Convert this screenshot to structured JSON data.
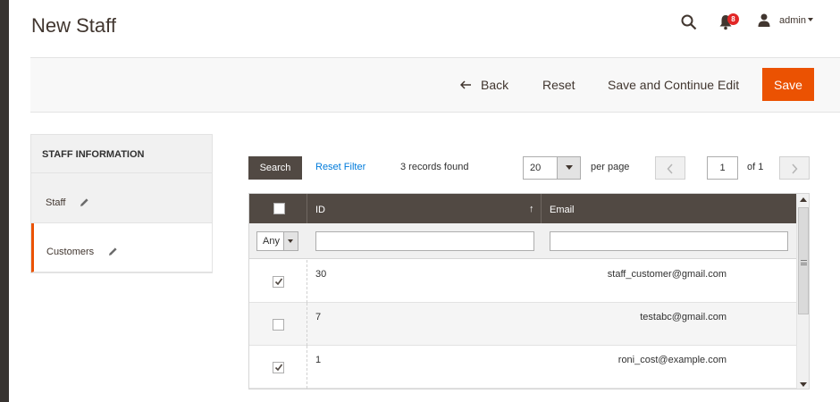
{
  "page": {
    "title": "New Staff"
  },
  "header": {
    "notifications_count": "8",
    "user_name": "admin",
    "icons": [
      "search-icon",
      "bell-icon",
      "user-icon"
    ]
  },
  "actions": {
    "back_label": "Back",
    "reset_label": "Reset",
    "save_continue_label": "Save and Continue Edit",
    "save_label": "Save",
    "accent_color": "#eb5202"
  },
  "sidebar": {
    "title": "STAFF INFORMATION",
    "items": [
      {
        "label": "Staff",
        "active": false
      },
      {
        "label": "Customers",
        "active": true
      }
    ]
  },
  "grid_toolbar": {
    "search_label": "Search",
    "reset_filter_label": "Reset Filter",
    "records_found": "3 records found",
    "per_page_value": "20",
    "per_page_label": "per page",
    "current_page": "1",
    "page_total": "of 1"
  },
  "grid": {
    "columns": {
      "id": "ID",
      "email": "Email",
      "sort_arrow": "↑"
    },
    "filter": {
      "any_label": "Any"
    },
    "rows": [
      {
        "checked": true,
        "id": "30",
        "email": "staff_customer@gmail.com"
      },
      {
        "checked": false,
        "id": "7",
        "email": "testabc@gmail.com"
      },
      {
        "checked": true,
        "id": "1",
        "email": "roni_cost@example.com"
      }
    ]
  }
}
